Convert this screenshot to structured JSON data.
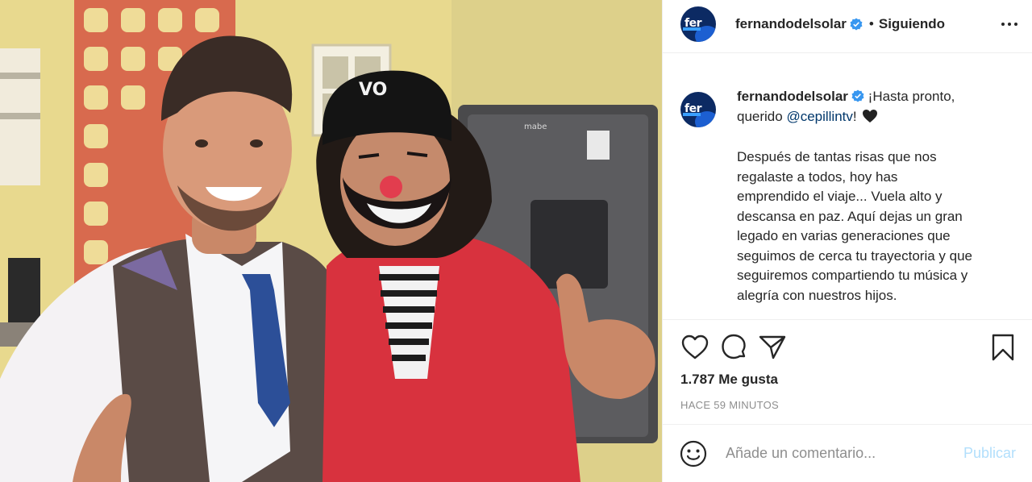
{
  "post": {
    "author": {
      "username": "fernandodelsolar",
      "avatar_text": "fer",
      "verified": true
    },
    "follow_separator": "•",
    "follow_status": "Siguiendo",
    "caption": {
      "username": "fernandodelsolar",
      "line1": "¡Hasta pronto,",
      "line2_pre": "querido ",
      "mention": "@cepillintv",
      "line2_post": "!",
      "emoji": "black-heart",
      "body_lines": [
        "Después de tantas risas que nos",
        "regalaste a todos, hoy has",
        "emprendido el viaje... Vuela alto y",
        "descansa en paz. Aquí dejas un gran",
        "legado en varias generaciones que",
        "seguimos de cerca tu trayectoria y que",
        "seguiremos compartiendo tu música y",
        "alegría con nuestros hijos."
      ]
    },
    "likes": "1.787 Me gusta",
    "time_ago": "HACE 59 MINUTOS",
    "comment": {
      "placeholder": "Añade un comentario...",
      "value": "",
      "publish_label": "Publicar"
    },
    "icons": {
      "like": "heart-outline-icon",
      "comment": "comment-bubble-icon",
      "share": "paper-plane-icon",
      "save": "bookmark-icon",
      "more": "more-options-icon",
      "emoji": "smiley-icon",
      "verified": "verified-badge-icon"
    },
    "colors": {
      "verified_blue": "#3897f0",
      "mention": "#00376b",
      "publish_disabled": "#b2dffc",
      "muted_text": "#8e8e8e",
      "text": "#262626"
    },
    "photo": {
      "cap_logo_text": "VO",
      "fridge_brand": "mabe"
    }
  }
}
